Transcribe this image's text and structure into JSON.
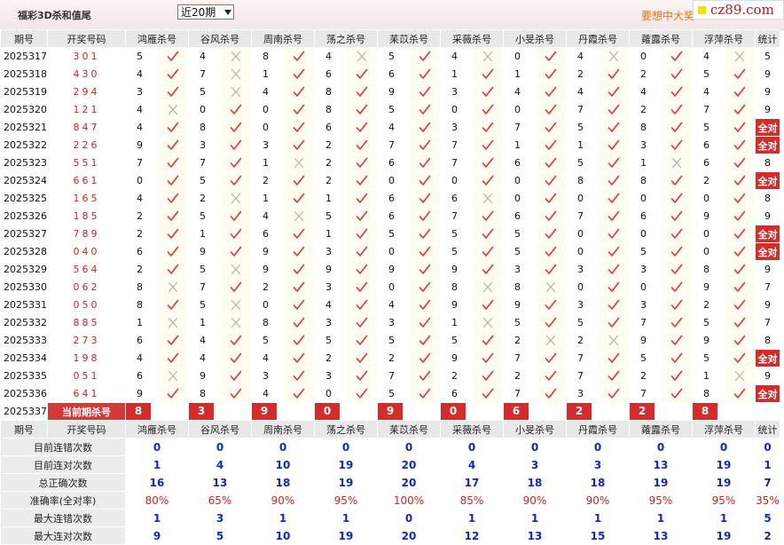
{
  "header": {
    "title": "福彩3D杀和值尾",
    "period_select": "近20期",
    "promo": "要想中大奖",
    "logo": "cz89.com"
  },
  "table": {
    "col_issue": "期号",
    "col_draw": "开奖号码",
    "col_total": "统计",
    "experts": [
      "鸿雁杀号",
      "谷风杀号",
      "周南杀号",
      "荡之杀号",
      "苿苡杀号",
      "采薇杀号",
      "小旻杀号",
      "丹霞杀号",
      "蕹露杀号",
      "浮萍杀号"
    ],
    "rows": [
      {
        "issue": "2025317",
        "draw": "301",
        "picks": [
          5,
          4,
          8,
          4,
          5,
          4,
          0,
          4,
          0,
          4
        ],
        "ok": [
          1,
          0,
          1,
          0,
          1,
          0,
          1,
          0,
          1,
          0
        ],
        "total": "5"
      },
      {
        "issue": "2025318",
        "draw": "430",
        "picks": [
          4,
          7,
          1,
          6,
          6,
          1,
          1,
          2,
          2,
          5
        ],
        "ok": [
          1,
          0,
          1,
          1,
          1,
          1,
          1,
          1,
          1,
          1
        ],
        "total": "9"
      },
      {
        "issue": "2025319",
        "draw": "294",
        "picks": [
          3,
          5,
          4,
          8,
          9,
          3,
          4,
          4,
          4,
          4
        ],
        "ok": [
          1,
          0,
          1,
          1,
          1,
          1,
          1,
          1,
          1,
          1
        ],
        "total": "9"
      },
      {
        "issue": "2025320",
        "draw": "121",
        "picks": [
          4,
          0,
          0,
          8,
          5,
          0,
          0,
          7,
          2,
          7
        ],
        "ok": [
          0,
          1,
          1,
          1,
          1,
          1,
          1,
          1,
          1,
          1
        ],
        "total": "9"
      },
      {
        "issue": "2025321",
        "draw": "847",
        "picks": [
          4,
          8,
          0,
          6,
          4,
          3,
          7,
          5,
          8,
          5
        ],
        "ok": [
          1,
          1,
          1,
          1,
          1,
          1,
          1,
          1,
          1,
          1
        ],
        "total": "全对"
      },
      {
        "issue": "2025322",
        "draw": "226",
        "picks": [
          9,
          3,
          3,
          2,
          7,
          7,
          1,
          1,
          3,
          6
        ],
        "ok": [
          1,
          1,
          1,
          1,
          1,
          1,
          1,
          1,
          1,
          1
        ],
        "total": "全对"
      },
      {
        "issue": "2025323",
        "draw": "551",
        "picks": [
          7,
          7,
          1,
          2,
          6,
          7,
          6,
          5,
          1,
          6
        ],
        "ok": [
          1,
          1,
          0,
          1,
          1,
          1,
          1,
          1,
          0,
          1
        ],
        "total": "8"
      },
      {
        "issue": "2025324",
        "draw": "661",
        "picks": [
          0,
          5,
          2,
          2,
          0,
          0,
          0,
          8,
          8,
          2
        ],
        "ok": [
          1,
          1,
          1,
          1,
          1,
          1,
          1,
          1,
          1,
          1
        ],
        "total": "全对"
      },
      {
        "issue": "2025325",
        "draw": "165",
        "picks": [
          4,
          2,
          1,
          1,
          6,
          6,
          0,
          0,
          0,
          0
        ],
        "ok": [
          1,
          0,
          1,
          1,
          1,
          0,
          1,
          1,
          1,
          1
        ],
        "total": "8"
      },
      {
        "issue": "2025326",
        "draw": "185",
        "picks": [
          2,
          5,
          4,
          5,
          6,
          7,
          6,
          7,
          6,
          9
        ],
        "ok": [
          1,
          1,
          0,
          1,
          1,
          1,
          1,
          1,
          1,
          1
        ],
        "total": "9"
      },
      {
        "issue": "2025327",
        "draw": "789",
        "picks": [
          2,
          1,
          6,
          1,
          5,
          5,
          5,
          0,
          0,
          0
        ],
        "ok": [
          1,
          1,
          1,
          1,
          1,
          1,
          1,
          1,
          1,
          1
        ],
        "total": "全对"
      },
      {
        "issue": "2025328",
        "draw": "040",
        "picks": [
          6,
          9,
          9,
          3,
          0,
          5,
          5,
          0,
          5,
          0
        ],
        "ok": [
          1,
          1,
          1,
          1,
          1,
          1,
          1,
          1,
          1,
          1
        ],
        "total": "全对"
      },
      {
        "issue": "2025329",
        "draw": "564",
        "picks": [
          2,
          5,
          9,
          9,
          9,
          9,
          3,
          3,
          3,
          8
        ],
        "ok": [
          1,
          0,
          1,
          1,
          1,
          1,
          1,
          1,
          1,
          1
        ],
        "total": "9"
      },
      {
        "issue": "2025330",
        "draw": "062",
        "picks": [
          8,
          7,
          2,
          3,
          0,
          8,
          8,
          0,
          0,
          9
        ],
        "ok": [
          0,
          1,
          1,
          1,
          1,
          0,
          0,
          1,
          1,
          1
        ],
        "total": "7"
      },
      {
        "issue": "2025331",
        "draw": "050",
        "picks": [
          8,
          5,
          0,
          4,
          4,
          9,
          9,
          3,
          3,
          2
        ],
        "ok": [
          1,
          0,
          1,
          1,
          1,
          1,
          1,
          1,
          1,
          1
        ],
        "total": "9"
      },
      {
        "issue": "2025332",
        "draw": "885",
        "picks": [
          1,
          1,
          8,
          3,
          3,
          1,
          5,
          5,
          7,
          5
        ],
        "ok": [
          0,
          0,
          1,
          1,
          1,
          0,
          1,
          1,
          1,
          1
        ],
        "total": "7"
      },
      {
        "issue": "2025333",
        "draw": "273",
        "picks": [
          6,
          4,
          5,
          5,
          5,
          5,
          2,
          2,
          9,
          9
        ],
        "ok": [
          1,
          1,
          1,
          1,
          1,
          1,
          0,
          0,
          1,
          1
        ],
        "total": "8"
      },
      {
        "issue": "2025334",
        "draw": "198",
        "picks": [
          4,
          4,
          4,
          2,
          2,
          9,
          7,
          7,
          5,
          5
        ],
        "ok": [
          1,
          1,
          1,
          1,
          1,
          1,
          1,
          1,
          1,
          1
        ],
        "total": "全对"
      },
      {
        "issue": "2025335",
        "draw": "051",
        "picks": [
          6,
          9,
          3,
          3,
          7,
          2,
          2,
          7,
          2,
          1
        ],
        "ok": [
          0,
          1,
          1,
          1,
          1,
          1,
          1,
          1,
          1,
          0
        ],
        "total": "9"
      },
      {
        "issue": "2025336",
        "draw": "641",
        "picks": [
          9,
          8,
          4,
          0,
          5,
          6,
          7,
          3,
          7,
          8
        ],
        "ok": [
          1,
          1,
          1,
          1,
          1,
          1,
          1,
          1,
          1,
          1
        ],
        "total": "全对"
      }
    ],
    "current": {
      "issue": "2025337",
      "label": "当前期杀号",
      "picks": [
        "8",
        "3",
        "9",
        "0",
        "9",
        "0",
        "6",
        "2",
        "2",
        "8"
      ]
    }
  },
  "stats": {
    "hdr_issue": "期号",
    "hdr_draw": "开奖号码",
    "rows": [
      {
        "label": "目前连错次数",
        "values": [
          "0",
          "0",
          "0",
          "0",
          "0",
          "0",
          "0",
          "0",
          "0",
          "0"
        ],
        "total": "0",
        "pct": false
      },
      {
        "label": "目前连对次数",
        "values": [
          "1",
          "4",
          "10",
          "19",
          "20",
          "4",
          "3",
          "3",
          "13",
          "19"
        ],
        "total": "1",
        "pct": false
      },
      {
        "label": "总正确次数",
        "values": [
          "16",
          "13",
          "18",
          "19",
          "20",
          "17",
          "18",
          "18",
          "19",
          "19"
        ],
        "total": "7",
        "pct": false
      },
      {
        "label": "准确率(全对率)",
        "values": [
          "80%",
          "65%",
          "90%",
          "95%",
          "100%",
          "85%",
          "90%",
          "90%",
          "95%",
          "95%"
        ],
        "total": "35%",
        "pct": true
      },
      {
        "label": "最大连错次数",
        "values": [
          "1",
          "3",
          "1",
          "1",
          "0",
          "1",
          "1",
          "1",
          "1",
          "1"
        ],
        "total": "5",
        "pct": false
      },
      {
        "label": "最大连对次数",
        "values": [
          "9",
          "5",
          "10",
          "19",
          "20",
          "12",
          "13",
          "15",
          "13",
          "19"
        ],
        "total": "2",
        "pct": false
      }
    ]
  },
  "colors": {
    "accent_red": "#d52b2b",
    "check_red": "#e0383e",
    "stat_blue": "#1027c6",
    "promo_orange": "#e8730f"
  }
}
